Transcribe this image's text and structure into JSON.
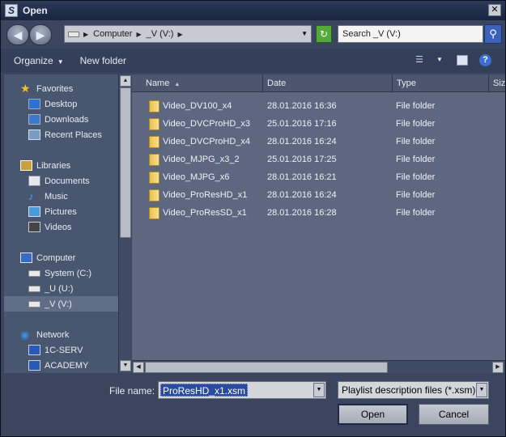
{
  "window": {
    "title": "Open"
  },
  "address": {
    "segments": [
      "Computer",
      "_V (V:)"
    ],
    "search_placeholder": "Search _V (V:)"
  },
  "toolbar": {
    "organize_label": "Organize",
    "new_folder_label": "New folder"
  },
  "nav": {
    "favorites": "Favorites",
    "desktop": "Desktop",
    "downloads": "Downloads",
    "recent": "Recent Places",
    "libraries": "Libraries",
    "documents": "Documents",
    "music": "Music",
    "pictures": "Pictures",
    "videos": "Videos",
    "computer": "Computer",
    "system": "System (C:)",
    "u_drive": "_U (U:)",
    "v_drive": "_V (V:)",
    "network": "Network",
    "serv": "1C-SERV",
    "academy": "ACADEMY"
  },
  "columns": {
    "name": "Name",
    "date": "Date",
    "type": "Type",
    "size": "Siz"
  },
  "files": [
    {
      "name": "Video_DV100_x4",
      "date": "28.01.2016 16:36",
      "type": "File folder"
    },
    {
      "name": "Video_DVCProHD_x3",
      "date": "25.01.2016 17:16",
      "type": "File folder"
    },
    {
      "name": "Video_DVCProHD_x4",
      "date": "28.01.2016 16:24",
      "type": "File folder"
    },
    {
      "name": "Video_MJPG_x3_2",
      "date": "25.01.2016 17:25",
      "type": "File folder"
    },
    {
      "name": "Video_MJPG_x6",
      "date": "28.01.2016 16:21",
      "type": "File folder"
    },
    {
      "name": "Video_ProResHD_x1",
      "date": "28.01.2016 16:24",
      "type": "File folder"
    },
    {
      "name": "Video_ProResSD_x1",
      "date": "28.01.2016 16:28",
      "type": "File folder"
    }
  ],
  "bottom": {
    "file_name_label": "File name:",
    "file_name_value": "ProResHD_x1.xsm",
    "file_type_value": "Playlist description files (*.xsm)",
    "open_label": "Open",
    "cancel_label": "Cancel"
  }
}
